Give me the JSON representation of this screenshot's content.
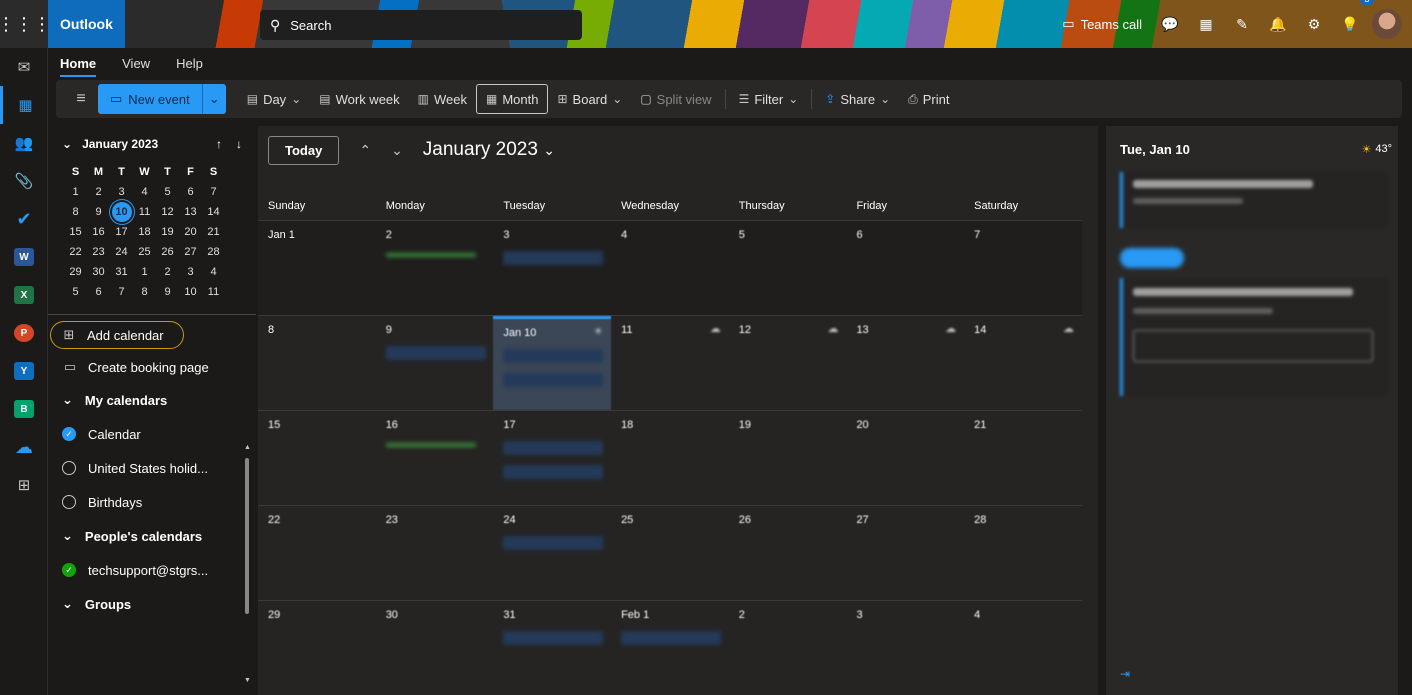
{
  "app": {
    "name": "Outlook",
    "waffle_icon": "waffle-icon"
  },
  "search": {
    "placeholder": "Search"
  },
  "topbar": {
    "teams_call": "Teams call",
    "notification_count": "3"
  },
  "ribbon": {
    "tabs": [
      "Home",
      "View",
      "Help"
    ],
    "active_tab": "Home"
  },
  "toolbar": {
    "new_event": "New event",
    "day": "Day",
    "work_week": "Work week",
    "week": "Week",
    "month": "Month",
    "board": "Board",
    "split_view": "Split view",
    "filter": "Filter",
    "share": "Share",
    "print": "Print"
  },
  "mini_calendar": {
    "title": "January 2023",
    "dow": [
      "S",
      "M",
      "T",
      "W",
      "T",
      "F",
      "S"
    ],
    "days": [
      "1",
      "2",
      "3",
      "4",
      "5",
      "6",
      "7",
      "8",
      "9",
      "10",
      "11",
      "12",
      "13",
      "14",
      "15",
      "16",
      "17",
      "18",
      "19",
      "20",
      "21",
      "22",
      "23",
      "24",
      "25",
      "26",
      "27",
      "28",
      "29",
      "30",
      "31",
      "1",
      "2",
      "3",
      "4",
      "5",
      "6",
      "7",
      "8",
      "9",
      "10",
      "11"
    ],
    "today": "10"
  },
  "leftpane": {
    "add_calendar": "Add calendar",
    "create_booking": "Create booking page",
    "my_calendars": "My calendars",
    "calendars": [
      "Calendar",
      "United States holid...",
      "Birthdays"
    ],
    "peoples_calendars": "People's calendars",
    "people": [
      "techsupport@stgrs..."
    ],
    "groups": "Groups"
  },
  "calendar": {
    "today_button": "Today",
    "month_label": "January 2023",
    "weekdays": [
      "Sunday",
      "Monday",
      "Tuesday",
      "Wednesday",
      "Thursday",
      "Friday",
      "Saturday"
    ],
    "weeks": [
      [
        "Jan 1",
        "2",
        "3",
        "4",
        "5",
        "6",
        "7"
      ],
      [
        "8",
        "9",
        "Jan 10",
        "11",
        "12",
        "13",
        "14"
      ],
      [
        "15",
        "16",
        "17",
        "18",
        "19",
        "20",
        "21"
      ],
      [
        "22",
        "23",
        "24",
        "25",
        "26",
        "27",
        "28"
      ],
      [
        "29",
        "30",
        "31",
        "Feb 1",
        "2",
        "3",
        "4"
      ]
    ]
  },
  "rightpane": {
    "date": "Tue, Jan 10",
    "temp": "43°"
  }
}
